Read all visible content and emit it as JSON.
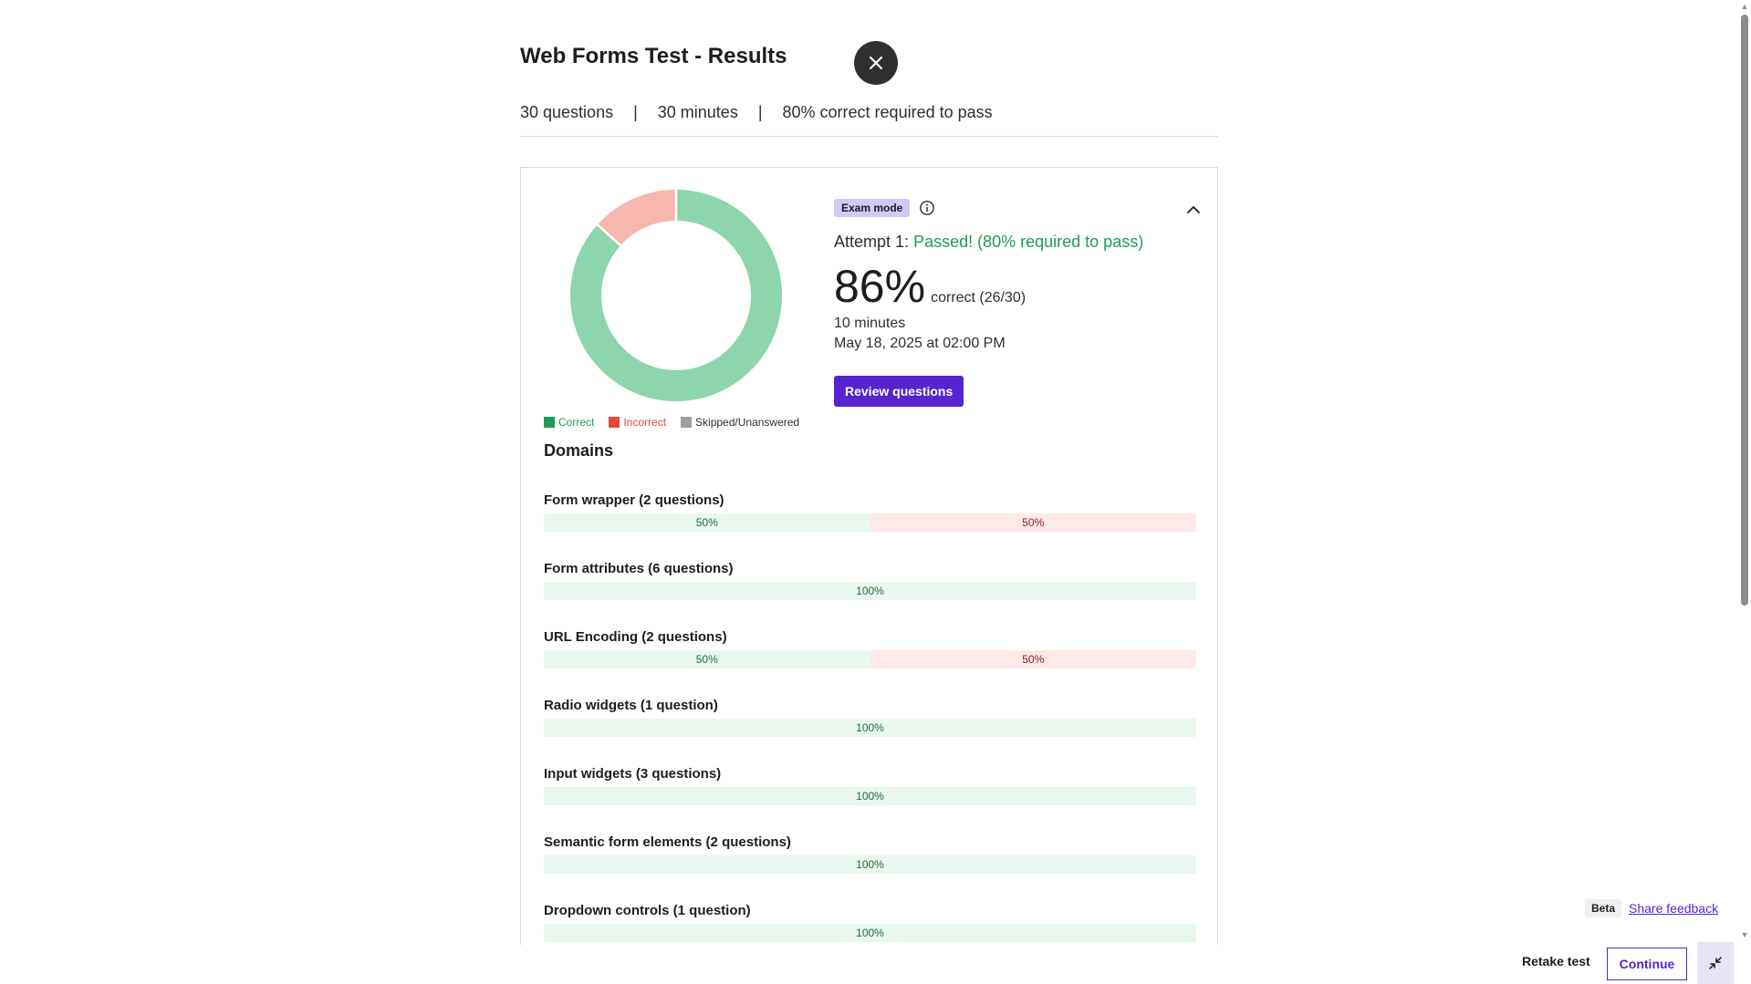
{
  "header": {
    "title": "Web Forms Test - Results",
    "meta": [
      "30 questions",
      "30 minutes",
      "80% correct required to pass"
    ],
    "separator": "|"
  },
  "result": {
    "mode_badge": "Exam mode",
    "attempt_prefix": "Attempt 1:",
    "attempt_status": "Passed! (80% required to pass)",
    "score": "86%",
    "score_label": "correct (26/30)",
    "duration": "10 minutes",
    "date": "May 18, 2025 at 02:00 PM",
    "review_label": "Review questions",
    "correct": 26,
    "incorrect": 4,
    "skipped": 0
  },
  "legend": {
    "correct": "Correct",
    "incorrect": "Incorrect",
    "skipped": "Skipped/Unanswered"
  },
  "colors": {
    "correct": "#8dd5ac",
    "incorrect": "#f7b6ae",
    "correct_swatch": "#1e9c55",
    "incorrect_swatch": "#e8473b",
    "skipped_swatch": "#9aa0a6",
    "accent": "#5624d0"
  },
  "domains": {
    "title": "Domains",
    "items": [
      {
        "name": "Form wrapper (2 questions)",
        "correct_pct": 50,
        "incorrect_pct": 50,
        "correct_label": "50%",
        "incorrect_label": "50%"
      },
      {
        "name": "Form attributes (6 questions)",
        "correct_pct": 100,
        "incorrect_pct": 0,
        "correct_label": "100%",
        "incorrect_label": ""
      },
      {
        "name": "URL Encoding (2 questions)",
        "correct_pct": 50,
        "incorrect_pct": 50,
        "correct_label": "50%",
        "incorrect_label": "50%"
      },
      {
        "name": "Radio widgets (1 question)",
        "correct_pct": 100,
        "incorrect_pct": 0,
        "correct_label": "100%",
        "incorrect_label": ""
      },
      {
        "name": "Input widgets (3 questions)",
        "correct_pct": 100,
        "incorrect_pct": 0,
        "correct_label": "100%",
        "incorrect_label": ""
      },
      {
        "name": "Semantic form elements (2 questions)",
        "correct_pct": 100,
        "incorrect_pct": 0,
        "correct_label": "100%",
        "incorrect_label": ""
      },
      {
        "name": "Dropdown controls (1 question)",
        "correct_pct": 100,
        "incorrect_pct": 0,
        "correct_label": "100%",
        "incorrect_label": ""
      }
    ]
  },
  "feedback": {
    "beta": "Beta",
    "share": "Share feedback"
  },
  "footer": {
    "retake": "Retake test",
    "continue": "Continue"
  }
}
